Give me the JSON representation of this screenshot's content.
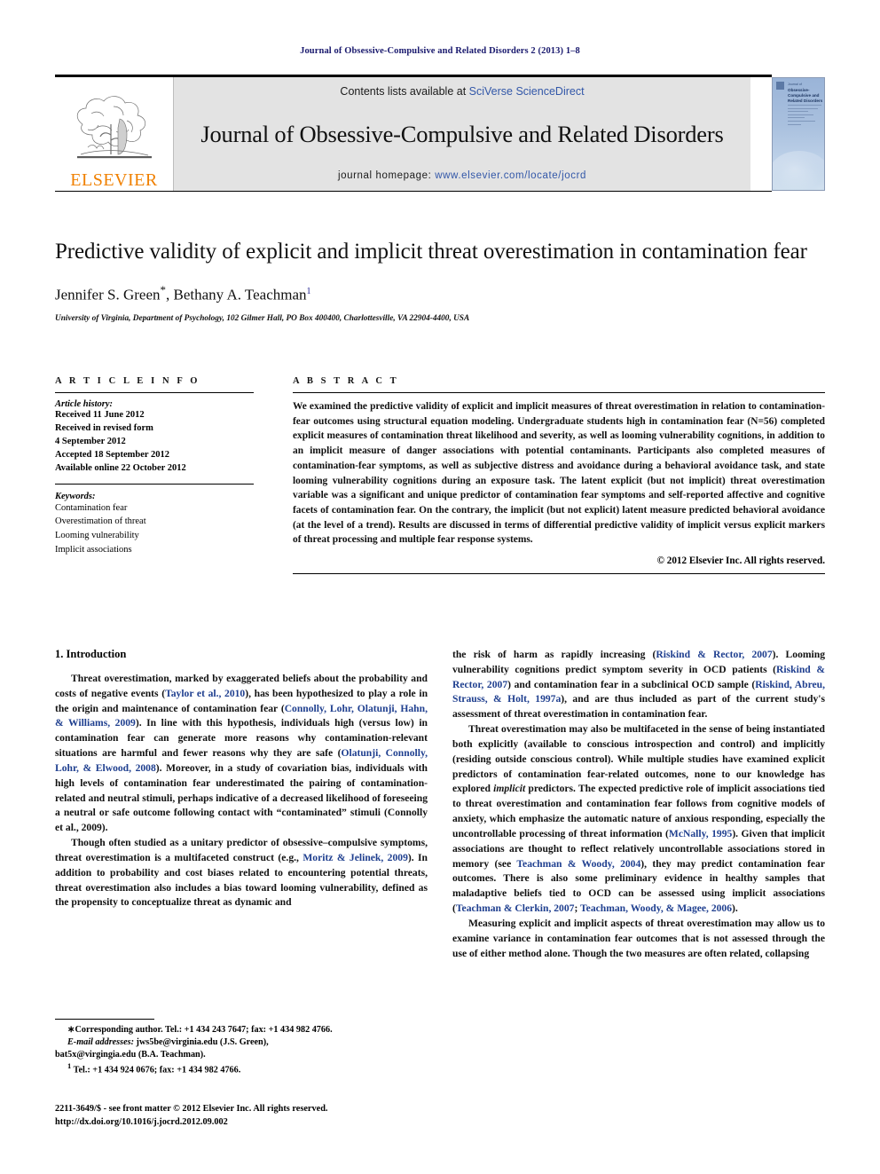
{
  "running_head": "Journal of Obsessive-Compulsive and Related Disorders 2 (2013) 1–8",
  "masthead": {
    "publisher_name": "ELSEVIER",
    "contents_prefix": "Contents lists available at ",
    "contents_link": "SciVerse ScienceDirect",
    "journal_title": "Journal of Obsessive-Compulsive and Related Disorders",
    "homepage_prefix": "journal homepage: ",
    "homepage_link": "www.elsevier.com/locate/jocrd",
    "cover": {
      "line1": "Journal of",
      "line2": "Obsessive-Compulsive and Related Disorders"
    }
  },
  "article": {
    "title": "Predictive validity of explicit and implicit threat overestimation in contamination fear",
    "authors": "Jennifer S. Green",
    "authors_second": ", Bethany A. Teachman",
    "corresponding_marker": "*",
    "author_note_marker": "1",
    "affiliation": "University of Virginia, Department of Psychology, 102 Gilmer Hall, PO Box 400400, Charlottesville, VA 22904-4400, USA"
  },
  "info": {
    "heading": "A R T I C L E   I N F O",
    "history_label": "Article history:",
    "history": [
      "Received 11 June 2012",
      "Received in revised form",
      "4 September 2012",
      "Accepted 18 September 2012",
      "Available online 22 October 2012"
    ],
    "keywords_label": "Keywords:",
    "keywords": [
      "Contamination fear",
      "Overestimation of threat",
      "Looming vulnerability",
      "Implicit associations"
    ]
  },
  "abstract": {
    "heading": "A B S T R A C T",
    "text": "We examined the predictive validity of explicit and implicit measures of threat overestimation in relation to contamination-fear outcomes using structural equation modeling. Undergraduate students high in contamination fear (N=56) completed explicit measures of contamination threat likelihood and severity, as well as looming vulnerability cognitions, in addition to an implicit measure of danger associations with potential contaminants. Participants also completed measures of contamination-fear symptoms, as well as subjective distress and avoidance during a behavioral avoidance task, and state looming vulnerability cognitions during an exposure task. The latent explicit (but not implicit) threat overestimation variable was a significant and unique predictor of contamination fear symptoms and self-reported affective and cognitive facets of contamination fear. On the contrary, the implicit (but not explicit) latent measure predicted behavioral avoidance (at the level of a trend). Results are discussed in terms of differential predictive validity of implicit versus explicit markers of threat processing and multiple fear response systems.",
    "copyright": "© 2012 Elsevier Inc. All rights reserved."
  },
  "body": {
    "section_heading": "1.  Introduction",
    "left": {
      "p1_a": "Threat overestimation, marked by exaggerated beliefs about the probability and costs of negative events (",
      "p1_c1": "Taylor et al., 2010",
      "p1_b": "), has been hypothesized to play a role in the origin and maintenance of contamination fear (",
      "p1_c2": "Connolly, Lohr, Olatunji, Hahn, & Williams, 2009",
      "p1_c": "). In line with this hypothesis, individuals high (versus low) in contamination fear can generate more reasons why contamination-relevant situations are harmful and fewer reasons why they are safe (",
      "p1_c3": "Olatunji, Connolly, Lohr, & Elwood, 2008",
      "p1_d": "). Moreover, in a study of covariation bias, individuals with high levels of contamination fear underestimated the pairing of contamination-related and neutral stimuli, perhaps indicative of a decreased likelihood of foreseeing a neutral or safe outcome following contact with “contaminated” stimuli (Connolly et al., 2009).",
      "p2_a": "Though often studied as a unitary predictor of obsessive–compulsive symptoms, threat overestimation is a multifaceted construct (e.g., ",
      "p2_c1": "Moritz & Jelinek, 2009",
      "p2_b": "). In addition to probability and cost biases related to encountering potential threats, threat overestimation also includes a bias toward looming vulnerability, defined as the propensity to conceptualize threat as dynamic and"
    },
    "right": {
      "p1_a": "the risk of harm as rapidly increasing (",
      "p1_c1": "Riskind & Rector, 2007",
      "p1_b": "). Looming vulnerability cognitions predict symptom severity in OCD patients (",
      "p1_c2": "Riskind & Rector, 2007",
      "p1_c": ") and contamination fear in a subclinical OCD sample (",
      "p1_c3": "Riskind, Abreu, Strauss, & Holt, 1997a",
      "p1_d": "), and are thus included as part of the current study's assessment of threat overestimation in contamination fear.",
      "p2_a": "Threat overestimation may also be multifaceted in the sense of being instantiated both explicitly (available to conscious introspection and control) and implicitly (residing outside conscious control). While multiple studies have examined explicit predictors of contamination fear-related outcomes, none to our knowledge has explored ",
      "p2_it": "implicit",
      "p2_b": " predictors. The expected predictive role of implicit associations tied to threat overestimation and contamination fear follows from cognitive models of anxiety, which emphasize the automatic nature of anxious responding, especially the uncontrollable processing of threat information (",
      "p2_c1": "McNally, 1995",
      "p2_c": "). Given that implicit associations are thought to reflect relatively uncontrollable associations stored in memory (see ",
      "p2_c2": "Teachman & Woody, 2004",
      "p2_d": "), they may predict contamination fear outcomes. There is also some preliminary evidence in healthy samples that maladaptive beliefs tied to OCD can be assessed using implicit associations (",
      "p2_c3": "Teachman & Clerkin, 2007",
      "p2_e": "; ",
      "p2_c4": "Teachman, Woody, & Magee, 2006",
      "p2_f": ").",
      "p3": "Measuring explicit and implicit aspects of threat overestimation may allow us to examine variance in contamination fear outcomes that is not assessed through the use of either method alone. Though the two measures are often related, collapsing"
    }
  },
  "footnotes": {
    "corresponding": "Corresponding author. Tel.: +1 434 243 7647; fax: +1 434 982 4766.",
    "email_label": "E-mail addresses:",
    "email_1": " jws5be@virginia.edu (J.S. Green),",
    "email_2": "bat5x@virgingia.edu (B.A. Teachman).",
    "note1_marker": "1",
    "note1": " Tel.: +1 434 924 0676; fax: +1 434 982 4766."
  },
  "imprint": {
    "line1": "2211-3649/$ - see front matter © 2012 Elsevier Inc. All rights reserved.",
    "line2": "http://dx.doi.org/10.1016/j.jocrd.2012.09.002"
  },
  "colors": {
    "citation_blue": "#1f3f8f",
    "link_blue": "#3257a8",
    "elsevier_orange": "#f08000",
    "masthead_grey": "#e3e3e3"
  }
}
